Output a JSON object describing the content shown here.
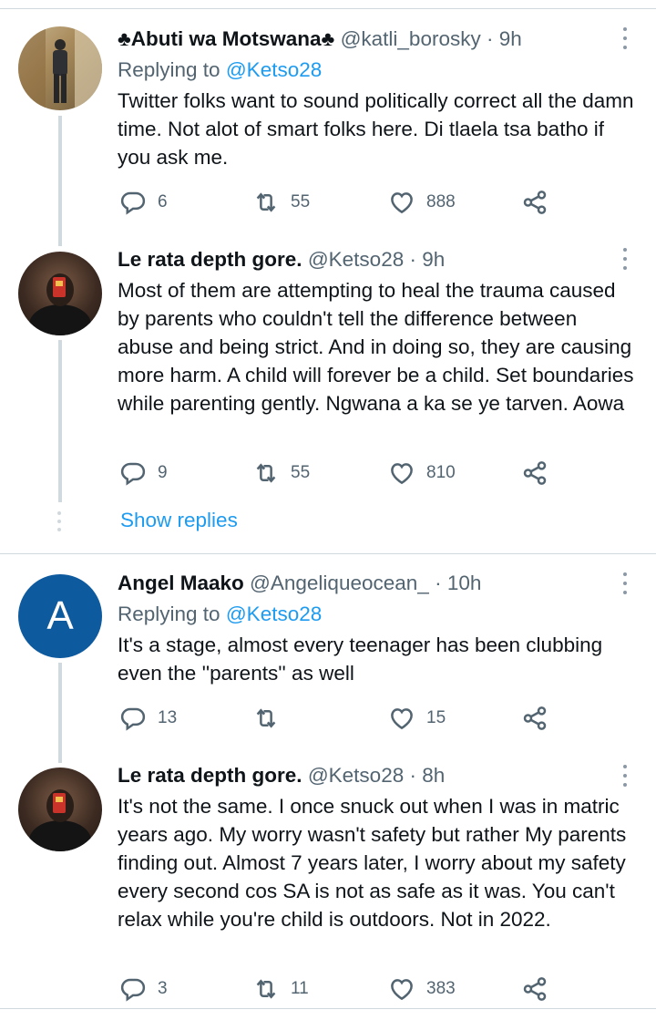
{
  "colors": {
    "link": "#1d9bf0",
    "muted": "#536471",
    "avatar_letter_bg": "#0e5a9e"
  },
  "tweets": [
    {
      "name": "♣Abuti wa Motswana♣",
      "handle": "@katli_borosky",
      "time": "9h",
      "reply_prefix": "Replying to",
      "reply_to": "@Ketso28",
      "body": "Twitter folks want to sound politically correct all the damn time. Not alot of smart folks here. Di tlaela tsa batho if you ask me.",
      "replies": "6",
      "retweets": "55",
      "likes": "888"
    },
    {
      "name": "Le rata depth gore.",
      "handle": "@Ketso28",
      "time": "9h",
      "body": "Most of them are attempting to heal the trauma caused by parents who couldn't tell the difference between abuse and being strict. And in doing so, they are causing more harm. A child will forever be a child. Set boundaries while parenting gently. Ngwana a ka se ye tarven. Aowa",
      "replies": "9",
      "retweets": "55",
      "likes": "810"
    },
    {
      "name": "Angel Maako",
      "handle": "@Angeliqueocean_",
      "time": "10h",
      "avatar_letter": "A",
      "reply_prefix": "Replying to",
      "reply_to": "@Ketso28",
      "body": "It's a stage, almost every teenager has been clubbing even the ''parents'' as well",
      "replies": "13",
      "retweets": "",
      "likes": "15"
    },
    {
      "name": "Le rata depth gore.",
      "handle": "@Ketso28",
      "time": "8h",
      "body": "It's not the same. I once snuck out when I was in matric years ago. My worry wasn't safety but rather My parents finding out. Almost 7 years later, I worry about my safety every second cos SA is not as safe as it was. You can't relax while you're child is outdoors. Not in 2022.",
      "replies": "3",
      "retweets": "11",
      "likes": "383"
    }
  ],
  "show_replies_label": "Show replies",
  "separator": "·"
}
